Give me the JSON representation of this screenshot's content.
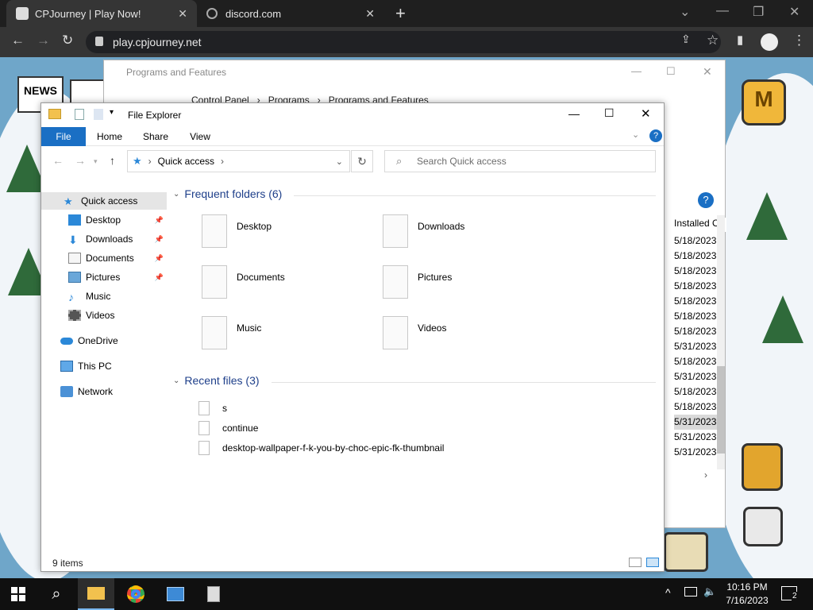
{
  "browser": {
    "tabs": [
      {
        "label": "CPJourney | Play Now!",
        "active": true
      },
      {
        "label": "discord.com",
        "active": false
      }
    ],
    "url": "play.cpjourney.net"
  },
  "game": {
    "news_sign": "NEWS",
    "badge_letter": "M"
  },
  "programs_window": {
    "title": "Programs and Features",
    "breadcrumb": [
      "Control Panel",
      "Programs",
      "Programs and Features"
    ],
    "column_header": "Installed O",
    "dates": [
      "5/18/2023",
      "5/18/2023",
      "5/18/2023",
      "5/18/2023",
      "5/18/2023",
      "5/18/2023",
      "5/18/2023",
      "5/31/2023",
      "5/18/2023",
      "5/31/2023",
      "5/18/2023",
      "5/18/2023",
      "5/31/2023",
      "5/31/2023",
      "5/31/2023"
    ]
  },
  "explorer": {
    "title": "File Explorer",
    "ribbon_tabs": [
      "File",
      "Home",
      "Share",
      "View"
    ],
    "address": "Quick access",
    "search_placeholder": "Search Quick access",
    "nav": {
      "quick_access": "Quick access",
      "items": [
        "Desktop",
        "Downloads",
        "Documents",
        "Pictures",
        "Music",
        "Videos"
      ],
      "onedrive": "OneDrive",
      "this_pc": "This PC",
      "network": "Network"
    },
    "frequent_header": "Frequent folders (6)",
    "frequent": [
      "Desktop",
      "Downloads",
      "Documents",
      "Pictures",
      "Music",
      "Videos"
    ],
    "recent_header": "Recent files (3)",
    "recent": [
      "s",
      "continue",
      "desktop-wallpaper-f-k-you-by-choc-epic-fk-thumbnail"
    ],
    "status": "9 items"
  },
  "taskbar": {
    "time": "10:16 PM",
    "date": "7/16/2023",
    "notifications": "2"
  },
  "colors": {
    "accent": "#1a6fc4",
    "taskbar": "#101010",
    "chrome_dark": "#353535"
  }
}
